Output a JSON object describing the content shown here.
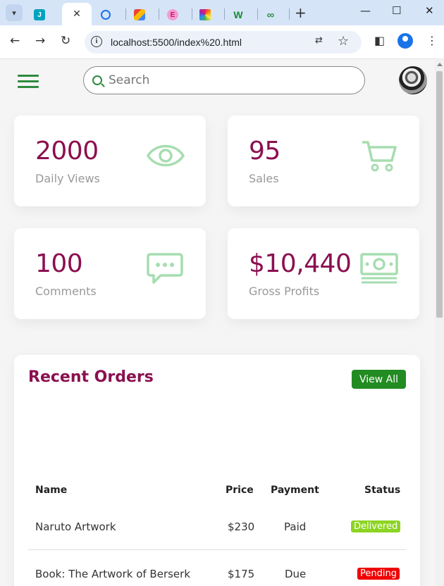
{
  "browser": {
    "tabs": [
      {
        "icon": "jira-icon",
        "letter": "J",
        "color": "#00a3bf"
      },
      {
        "icon": "active-tab-close-icon",
        "close": "✕"
      },
      {
        "icon": "chrome-tab-icon",
        "color": "#1a73e8"
      },
      {
        "icon": "apps-tab-icon",
        "color": "#4285f4"
      },
      {
        "icon": "elementor-tab-icon",
        "letter": "E",
        "color": "#f59bd4"
      },
      {
        "icon": "colorful-tab-icon",
        "color": "#e91e63"
      },
      {
        "icon": "w-tab-icon",
        "letter": "W",
        "color": "#1a8a2e"
      },
      {
        "icon": "geeks-tab-icon",
        "letter": "∞",
        "color": "#2f8d46"
      }
    ],
    "new_tab": "+",
    "window_controls": [
      "—",
      "☐",
      "✕"
    ],
    "url": "localhost:5500/index%20.html"
  },
  "header": {
    "search_placeholder": "Search"
  },
  "cards": [
    {
      "value": "2000",
      "label": "Daily Views",
      "icon": "eye-icon"
    },
    {
      "value": "95",
      "label": "Sales",
      "icon": "cart-icon"
    },
    {
      "value": "100",
      "label": "Comments",
      "icon": "comment-icon"
    },
    {
      "value": "$10,440",
      "label": "Gross Profits",
      "icon": "cash-icon"
    }
  ],
  "orders": {
    "title": "Recent Orders",
    "view_all": "View All",
    "headers": {
      "name": "Name",
      "price": "Price",
      "payment": "Payment",
      "status": "Status"
    },
    "rows": [
      {
        "name": "Naruto Artwork",
        "price": "$230",
        "payment": "Paid",
        "status": "Delivered",
        "status_color": "#8cd422"
      },
      {
        "name": "Book: The Artwork of Berserk",
        "price": "$175",
        "payment": "Due",
        "status": "Pending",
        "status_color": "#f00000"
      }
    ]
  },
  "colors": {
    "accent": "#8b1050",
    "green": "#2e8b3e",
    "icon_green": "#a6ddb0",
    "button": "#228b22"
  }
}
